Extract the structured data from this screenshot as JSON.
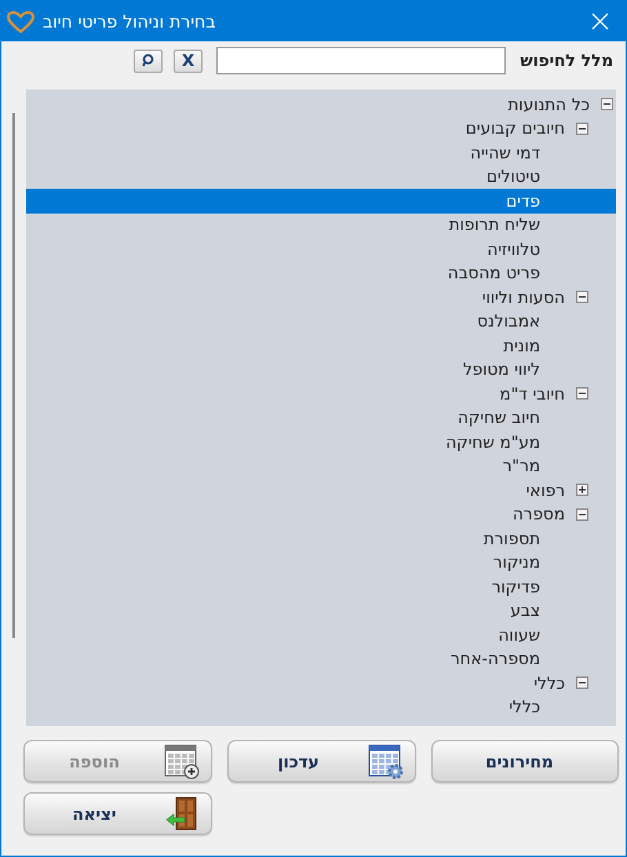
{
  "window": {
    "title": "בחירת וניהול פריטי חיוב"
  },
  "search": {
    "label": "מלל לחיפוש",
    "clear_button": "X"
  },
  "tree": [
    {
      "label": "כל התנועות",
      "selected": false,
      "expanded": true,
      "children": [
        {
          "label": "חיובים קבועים",
          "selected": false,
          "expanded": true,
          "children": [
            {
              "label": "דמי שהייה",
              "selected": false
            },
            {
              "label": "טיטולים",
              "selected": false
            },
            {
              "label": "פדים",
              "selected": true
            },
            {
              "label": "שליח תרופות",
              "selected": false
            },
            {
              "label": "טלוויזיה",
              "selected": false
            },
            {
              "label": "פריט מהסבה",
              "selected": false
            }
          ]
        },
        {
          "label": "הסעות וליווי",
          "selected": false,
          "expanded": true,
          "children": [
            {
              "label": "אמבולנס",
              "selected": false
            },
            {
              "label": "מונית",
              "selected": false
            },
            {
              "label": "ליווי מטופל",
              "selected": false
            }
          ]
        },
        {
          "label": "חיובי ד\"מ",
          "selected": false,
          "expanded": true,
          "children": [
            {
              "label": "חיוב שחיקה",
              "selected": false
            },
            {
              "label": "מע\"מ שחיקה",
              "selected": false
            },
            {
              "label": "מר\"ר",
              "selected": false
            }
          ]
        },
        {
          "label": "רפואי",
          "selected": false,
          "expanded": false
        },
        {
          "label": "מספרה",
          "selected": false,
          "expanded": true,
          "children": [
            {
              "label": "תספורת",
              "selected": false
            },
            {
              "label": "מניקור",
              "selected": false
            },
            {
              "label": "פדיקור",
              "selected": false
            },
            {
              "label": "צבע",
              "selected": false
            },
            {
              "label": "שעווה",
              "selected": false
            },
            {
              "label": "מספרה-אחר",
              "selected": false
            }
          ]
        },
        {
          "label": "כללי",
          "selected": false,
          "expanded": true,
          "children": [
            {
              "label": "כללי",
              "selected": false
            }
          ]
        }
      ]
    }
  ],
  "buttons": [
    {
      "label": "מחירונים",
      "kind": "plain",
      "disabled": false
    },
    {
      "label": "עדכון",
      "kind": "update",
      "disabled": false
    },
    {
      "label": "הוספה",
      "kind": "add",
      "disabled": true
    },
    {
      "label": "יציאה",
      "kind": "exit",
      "disabled": false
    }
  ]
}
